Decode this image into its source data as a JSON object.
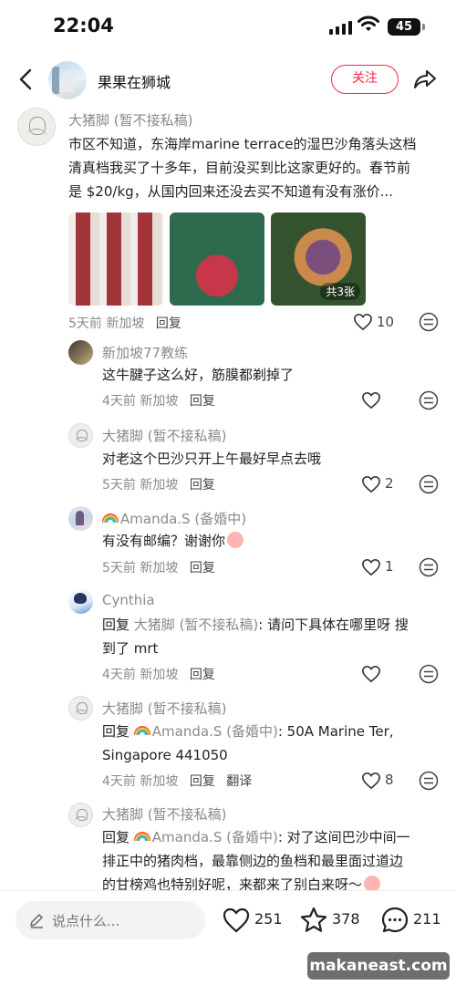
{
  "status_bar": {
    "time": "22:04",
    "battery": "45"
  },
  "header": {
    "username": "果果在狮城",
    "follow_label": "关注"
  },
  "comments": [
    {
      "name": "大猪脚 (暂不接私稿)",
      "lines": [
        "市区不知道，东海岸marine terrace的湿巴沙角落头这档",
        "清真档我买了十多年，目前没买到比这家更好的。春节前",
        "是 $20/kg，从国内回来还没去买不知道有没有涨价..."
      ],
      "photos_badge": "共3张",
      "time": "5天前",
      "location": "新加坡",
      "reply_label": "回复",
      "likes": "10"
    },
    {
      "name": "新加坡77教练",
      "text": "这牛腱子这么好，筋膜都剃掉了",
      "time": "4天前",
      "location": "新加坡",
      "reply_label": "回复",
      "likes": ""
    },
    {
      "name": "大猪脚 (暂不接私稿)",
      "text": "对老这个巴沙只开上午最好早点去哦",
      "time": "5天前",
      "location": "新加坡",
      "reply_label": "回复",
      "likes": "2"
    },
    {
      "name": "Amanda.S (备婚中)",
      "text": "有没有邮编？谢谢你",
      "time": "5天前",
      "location": "新加坡",
      "reply_label": "回复",
      "likes": "1"
    },
    {
      "name": "Cynthia",
      "reply_prefix": "回复",
      "reply_to": "大猪脚 (暂不接私稿)",
      "line1": ": 请问下具体在哪里呀 搜",
      "line2": "到了 mrt",
      "time": "4天前",
      "location": "新加坡",
      "reply_label": "回复",
      "likes": ""
    },
    {
      "name": "大猪脚 (暂不接私稿)",
      "reply_prefix": "回复",
      "reply_to": "Amanda.S (备婚中)",
      "line1": ": 50A Marine Ter,",
      "line2": "Singapore 441050",
      "time": "4天前",
      "location": "新加坡",
      "reply_label": "回复",
      "translate_label": "翻译",
      "likes": "8"
    },
    {
      "name": "大猪脚 (暂不接私稿)",
      "reply_prefix": "回复",
      "reply_to": "Amanda.S (备婚中)",
      "line1": ": 对了这间巴沙中间一",
      "line2": "排正中的猪肉档，最靠侧边的鱼档和最里面过道边",
      "line3": "的甘榜鸡也特别好呢，来都来了别白来呀～"
    }
  ],
  "bottom_bar": {
    "input_placeholder": "说点什么...",
    "likes": "251",
    "collects": "378",
    "comments": "211"
  },
  "watermark": "makaneast.com"
}
